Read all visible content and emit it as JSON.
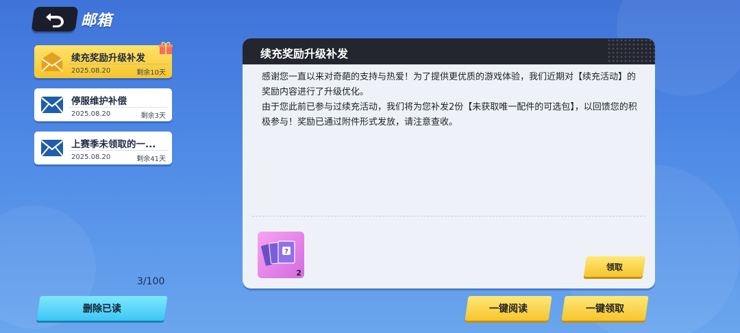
{
  "header": {
    "title": "邮箱"
  },
  "mails": [
    {
      "subject": "续充奖励升级补发",
      "date": "2025.08.20",
      "remaining": "剩余10天",
      "selected": true,
      "has_gift": true
    },
    {
      "subject": "停服维护补偿",
      "date": "2025.08.20",
      "remaining": "剩余3天",
      "selected": false,
      "has_gift": false
    },
    {
      "subject": "上赛季未领取的一...",
      "date": "2025.08.20",
      "remaining": "剩余41天",
      "selected": false,
      "has_gift": false
    }
  ],
  "mail_count": "3/100",
  "buttons": {
    "delete_read": "删除已读",
    "claim": "领取",
    "read_all": "一键阅读",
    "claim_all": "一键领取"
  },
  "detail": {
    "title": "续充奖励升级补发",
    "paragraphs": [
      "感谢您一直以来对奇葩的支持与热爱！为了提供更优质的游戏体验，我们近期对【续充活动】的奖励内容进行了升级优化。",
      "由于您此前已参与过续充活动，我们将为您补发2份【未获取唯一配件的可选包】，以回馈您的积极参与！奖励已通过附件形式发放，请注意查收。"
    ],
    "attachment": {
      "quantity": "2",
      "icon": "card-pack-icon"
    }
  },
  "colors": {
    "selected_mail": "#f6c52d",
    "panel_header": "#23252f",
    "accent_yellow": "#f6c52b",
    "accent_cyan": "#3cc6f4"
  }
}
